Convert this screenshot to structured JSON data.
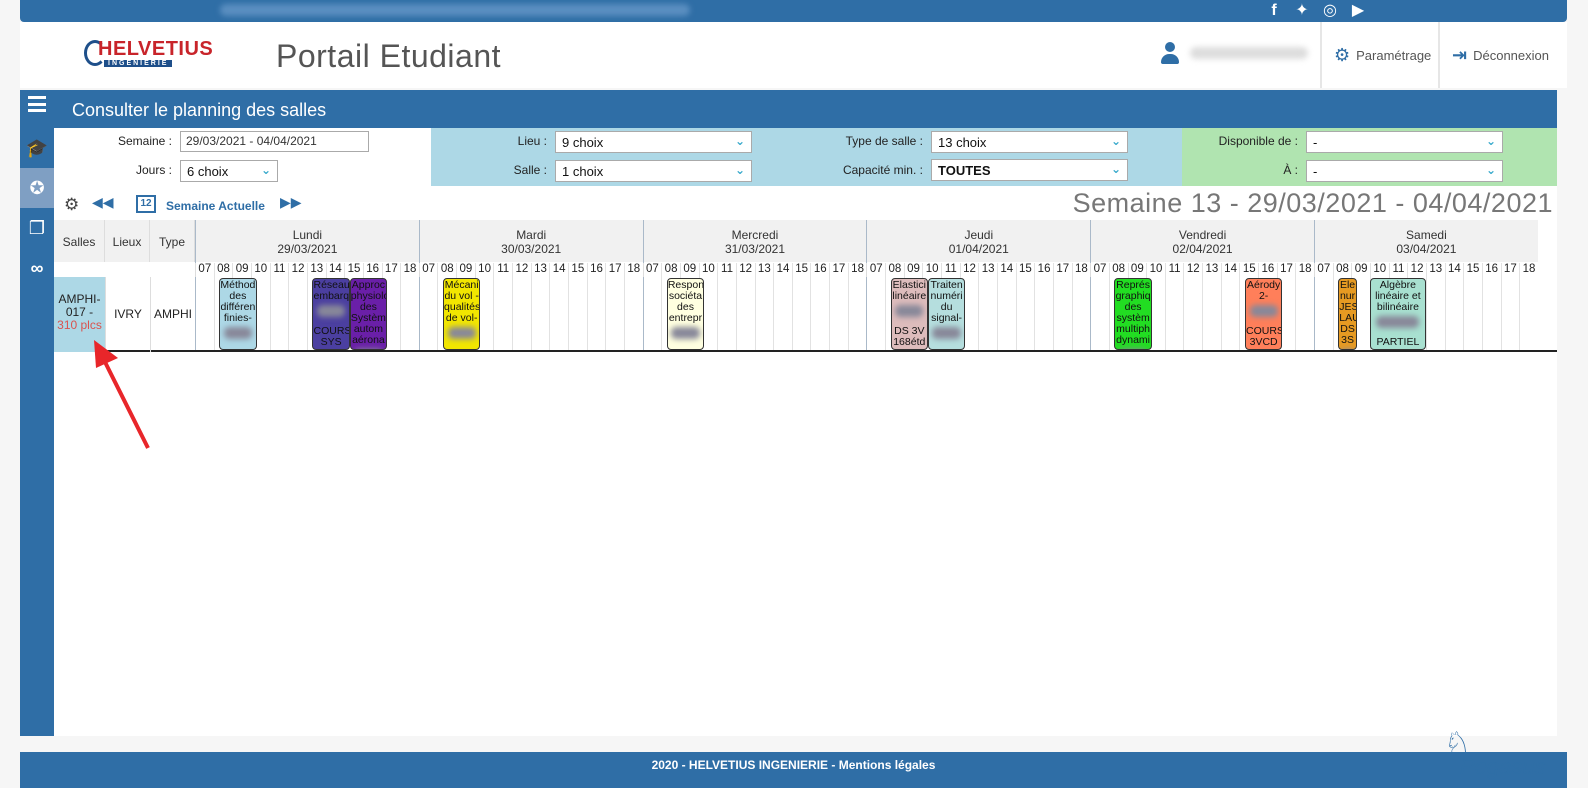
{
  "header": {
    "portal_title": "Portail Etudiant",
    "logo_text": "HELVETIUS",
    "logo_sub": "INGENIERIE",
    "settings_label": "Paramétrage",
    "logout_label": "Déconnexion"
  },
  "topbar": {
    "social": [
      "f",
      "t",
      "ig",
      "yt"
    ]
  },
  "panel": {
    "title": "Consulter le planning des salles"
  },
  "filters": {
    "semaine_label": "Semaine :",
    "semaine_value": "29/03/2021 - 04/04/2021",
    "jours_label": "Jours :",
    "jours_value": "6 choix",
    "lieu_label": "Lieu :",
    "lieu_value": "9 choix",
    "salle_label": "Salle :",
    "salle_value": "1 choix",
    "type_salle_label": "Type de salle :",
    "type_salle_value": "13 choix",
    "capacite_label": "Capacité min. :",
    "capacite_value": "TOUTES",
    "dispo_label": "Disponible de :",
    "dispo_value": "-",
    "a_label": "À :",
    "a_value": "-"
  },
  "toolbar": {
    "current_week_label": "Semaine Actuelle",
    "calendar_day": "12",
    "week_title": "Semaine 13 - 29/03/2021 - 04/04/2021"
  },
  "grid": {
    "col_salles": "Salles",
    "col_lieux": "Lieux",
    "col_type": "Type",
    "hours": [
      "07",
      "08",
      "09",
      "10",
      "11",
      "12",
      "13",
      "14",
      "15",
      "16",
      "17",
      "18"
    ],
    "days": [
      {
        "name": "Lundi",
        "date": "29/03/2021"
      },
      {
        "name": "Mardi",
        "date": "30/03/2021"
      },
      {
        "name": "Mercredi",
        "date": "31/03/2021"
      },
      {
        "name": "Jeudi",
        "date": "01/04/2021"
      },
      {
        "name": "Vendredi",
        "date": "02/04/2021"
      },
      {
        "name": "Samedi",
        "date": "03/04/2021"
      }
    ],
    "row": {
      "room": "AMPHI-017 -",
      "capacity": "310 plcs",
      "lieu": "IVRY",
      "type": "AMPHI"
    },
    "events": [
      {
        "day": 0,
        "start": 1.3,
        "end": 3.3,
        "color": "#add8e6",
        "text": "Méthod des différen finies-",
        "bottom": ""
      },
      {
        "day": 0,
        "start": 6.3,
        "end": 8.3,
        "color": "#4b3fa0",
        "text": "Réseau embarq",
        "bottom": "COURS SYS"
      },
      {
        "day": 0,
        "start": 8.3,
        "end": 10.3,
        "color": "#6a1fa8",
        "text": "Approc physiolo des Systèm autom aérona",
        "bottom": ""
      },
      {
        "day": 1,
        "start": 1.3,
        "end": 3.3,
        "color": "#f2e600",
        "text": "Mécani du vol - qualités de vol-",
        "bottom": ""
      },
      {
        "day": 2,
        "start": 1.3,
        "end": 3.3,
        "color": "#ffffe0",
        "text": "Respon sociéta des entrepr",
        "bottom": ""
      },
      {
        "day": 3,
        "start": 1.3,
        "end": 3.3,
        "color": "#ddbcbc",
        "text": "Elastici linéaire",
        "bottom": "DS 3V 168étd"
      },
      {
        "day": 3,
        "start": 3.3,
        "end": 5.3,
        "color": "#b5dede",
        "text": "Traiten numéri du signal-",
        "bottom": ""
      },
      {
        "day": 4,
        "start": 1.3,
        "end": 3.3,
        "color": "#22dd22",
        "text": "Représ graphiq des systèm multiph dynami",
        "bottom": ""
      },
      {
        "day": 4,
        "start": 8.3,
        "end": 10.3,
        "color": "#ff7f5a",
        "text": "Aérody 2-",
        "bottom": "COURS 3VCD"
      },
      {
        "day": 5,
        "start": 1.3,
        "end": 2.3,
        "color": "#e69a22",
        "text": "Ele nur JES LAU DS 3S",
        "bottom": ""
      },
      {
        "day": 5,
        "start": 3.0,
        "end": 6.0,
        "color": "#a8e0d0",
        "text": "Algèbre linéaire et bilinéaire",
        "bottom": "PARTIEL"
      }
    ]
  },
  "footer": {
    "text": "2020 - HELVETIUS INGENIERIE - Mentions légales"
  },
  "brand": {
    "pegasus": "Pegasus"
  }
}
